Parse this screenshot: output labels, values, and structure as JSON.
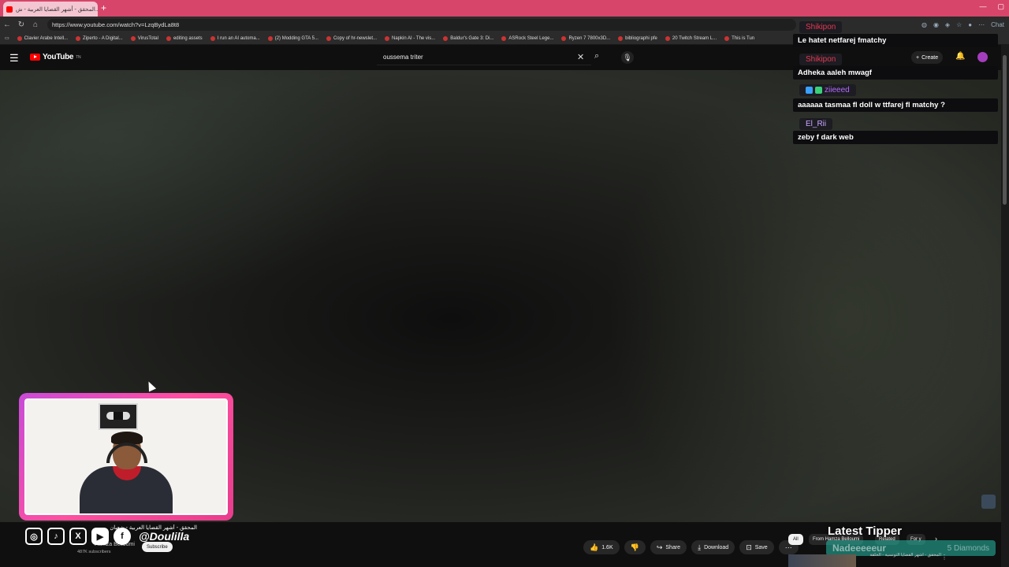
{
  "browser": {
    "tab_title": "المحقق - أشهر القضايا العربية - ش...",
    "url": "https://www.youtube.com/watch?v=LzqBydLa8t8",
    "bookmarks": [
      "Clavier Arabe Intell...",
      "Ziperto - A Digital...",
      "VirusTotal",
      "editing assets",
      "I run an AI automa...",
      "(2) Modding GTA 5...",
      "Copy of hr-newslet...",
      "Napkin AI - The vis...",
      "Baldur's Gate 3: Di...",
      "ASRock Steel Lege...",
      "Ryzen 7 7800x3D...",
      "bibliographi pfe",
      "20 Twitch Stream L...",
      "This is Tun"
    ],
    "chat_ext_label": "Chat"
  },
  "youtube": {
    "logo_text": "YouTube",
    "logo_sup": "TN",
    "search_value": "oussema triter",
    "create_label": "Create"
  },
  "video": {
    "title": "المحقق - أشهر القضايا العربية - شعبان وقصة...",
    "channel_name": "Hamza Belloumi",
    "subscribers": "487K subscribers",
    "subscribe_label": "Subscribe",
    "likes": "1.6K",
    "share_label": "Share",
    "download_label": "Download",
    "save_label": "Save"
  },
  "overlay": {
    "handle": "@Doulilla",
    "socials": [
      "instagram-icon",
      "tiktok-icon",
      "x-icon",
      "youtube-icon",
      "facebook-icon"
    ]
  },
  "chips": {
    "all": "All",
    "from": "From Hamza Belloumi",
    "related": "Related",
    "for": "For y"
  },
  "tipper": {
    "title": "Latest Tipper",
    "name": "Nadeeeeeur",
    "amount": "5 Diamonds"
  },
  "recommended": {
    "title": "المحقق - أشهر القضايا التونسية - الحلقة"
  },
  "chat": [
    {
      "user": "Shikipon",
      "color": "#e8384f",
      "message": "Le hatet netfarej fmatchy"
    },
    {
      "user": "Shikipon",
      "color": "#e8384f",
      "message": "Adheka aaleh mwagf"
    },
    {
      "user": "ziieeed",
      "color": "#b46cff",
      "message": "aaaaaa tasmaa fl doll w ttfarej fl matchy ?"
    },
    {
      "user": "El_Rii",
      "color": "#c9a7ff",
      "message": "zeby f dark web"
    }
  ]
}
